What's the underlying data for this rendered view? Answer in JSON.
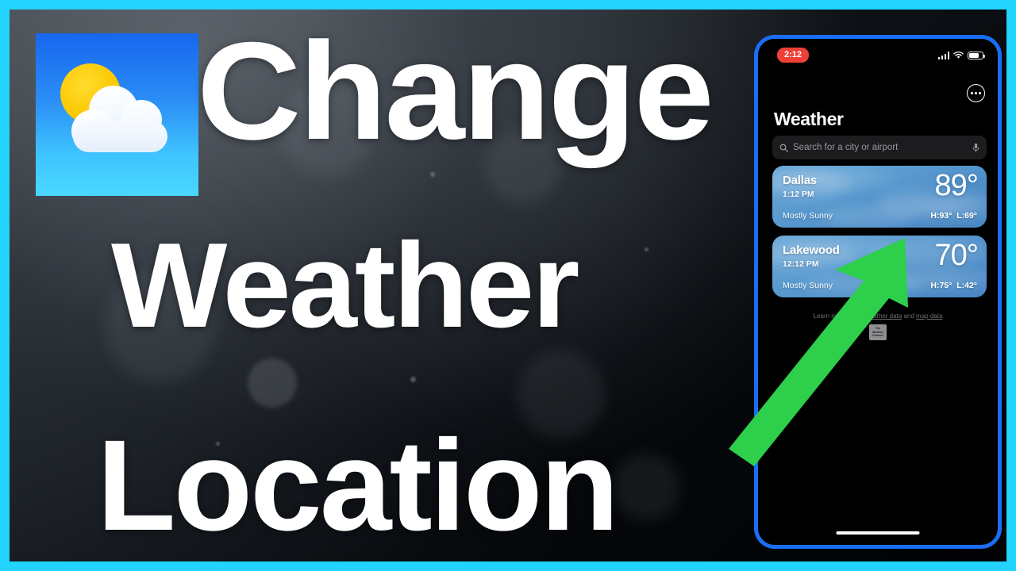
{
  "theme": {
    "outer_border_color": "#22d3ff",
    "phone_frame_color": "#1a6ef5",
    "arrow_color": "#2ecf4a",
    "time_pill_color": "#ee4036",
    "card_color": "#5696cd",
    "headline_color": "#ffffff"
  },
  "thumbnail": {
    "headline_lines": [
      "Change",
      "Weather",
      "Location"
    ],
    "app_icon_name": "weather-app-icon"
  },
  "phone": {
    "status_bar": {
      "time": "2:12",
      "signal_icon": "cellular-signal-icon",
      "wifi_icon": "wifi-icon",
      "battery_icon": "battery-icon",
      "battery_level": 63
    },
    "more_button_label": "More",
    "title": "Weather",
    "search": {
      "placeholder": "Search for a city or airport",
      "search_icon": "search-icon",
      "mic_icon": "microphone-icon"
    },
    "cards": [
      {
        "city": "Dallas",
        "time": "1:12 PM",
        "condition": "Mostly Sunny",
        "temp": "89°",
        "high": "H:93°",
        "low": "L:69°"
      },
      {
        "city": "Lakewood",
        "time": "12:12 PM",
        "condition": "Mostly Sunny",
        "temp": "70°",
        "high": "H:75°",
        "low": "L:42°"
      }
    ],
    "footer": {
      "lead": "Learn more about ",
      "link_weather": "weather data",
      "middle": " and ",
      "link_map": "map data",
      "logo_line1": "The",
      "logo_line2": "Weather",
      "logo_line3": "Channel"
    },
    "home_indicator": "home-indicator"
  }
}
